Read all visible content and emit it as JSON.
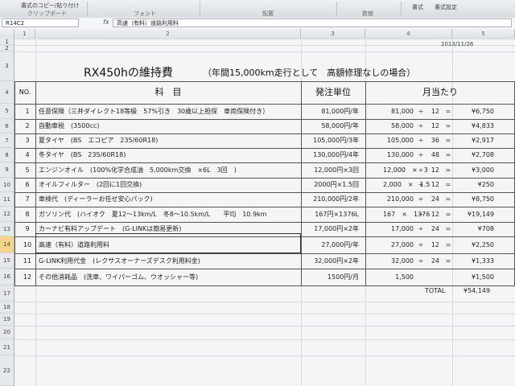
{
  "ribbon": {
    "copy_format": "書式のコピー/貼り付け",
    "group_clipboard": "クリップボード",
    "group_font": "フォント",
    "group_align": "配置",
    "group_number": "数値",
    "format_label": "書式",
    "style_label": "書式設定"
  },
  "formula_bar": {
    "name_box": "R14C2",
    "fx": "fx",
    "content": "高速（有料）道路利用料"
  },
  "columns": [
    "1",
    "2",
    "3",
    "4",
    "5"
  ],
  "rows": [
    "1",
    "2",
    "3",
    "4",
    "5",
    "6",
    "7",
    "8",
    "9",
    "10",
    "11",
    "12",
    "13",
    "14",
    "15",
    "16",
    "17",
    "18",
    "19",
    "20",
    "21",
    "22"
  ],
  "sheet": {
    "date": "2013/11/26",
    "title": "RX450hの維持費",
    "subtitle": "（年間15,000km走行として　高額修理なしの場合）",
    "headers": {
      "no": "NO.",
      "item": "科　目",
      "unit": "発注単位",
      "monthly": "月当たり"
    },
    "items": [
      {
        "no": "1",
        "name": "任意保険（三井ダイレクト18等級　57%引き　30歳以上担保　車両保険付き）",
        "unit": "81,000円/年",
        "a": "81,000",
        "op": "÷",
        "b": "12",
        "eq": "=",
        "result": "¥6,750"
      },
      {
        "no": "2",
        "name": "自動車税　(3500cc)",
        "unit": "58,000円/年",
        "a": "58,000",
        "op": "÷",
        "b": "12",
        "eq": "=",
        "result": "¥4,833"
      },
      {
        "no": "3",
        "name": "夏タイヤ　(BS　エコピア　235/60R18)",
        "unit": "105,000円/3年",
        "a": "105,000",
        "op": "÷",
        "b": "36",
        "eq": "=",
        "result": "¥2,917"
      },
      {
        "no": "4",
        "name": "冬タイヤ　(BS　235/60R18)",
        "unit": "130,000円/4年",
        "a": "130,000",
        "op": "÷",
        "b": "48",
        "eq": "=",
        "result": "¥2,708"
      },
      {
        "no": "5",
        "name": "エンジンオイル　(100%化学合成油　5,000km交換　×6L　3回　)",
        "unit": "12,000円×3回",
        "a": "12,000　×　3",
        "op": "÷",
        "b": "12",
        "eq": "=",
        "result": "¥3,000"
      },
      {
        "no": "6",
        "name": "オイルフィルター　(2回に1回交換)",
        "unit": "2000円×1.5回",
        "a": "2,000　×　1.5",
        "op": "÷",
        "b": "12",
        "eq": "=",
        "result": "¥250"
      },
      {
        "no": "7",
        "name": "車検代　(ディーラーお任せ安心パック)",
        "unit": "210,000円/2年",
        "a": "210,000",
        "op": "÷",
        "b": "24",
        "eq": "=",
        "result": "¥8,750"
      },
      {
        "no": "8",
        "name": "ガソリン代　(ハイオク　夏12～13km/L　冬8～10.5km/L　　平均　10.9km",
        "unit": "167円×1376L",
        "a": "167　×　1376",
        "op": "÷",
        "b": "12",
        "eq": "=",
        "result": "¥19,149"
      },
      {
        "no": "9",
        "name": "カーナビ有料アップデート　(G-LINKは簡易更新)",
        "unit": "17,000円×2年",
        "a": "17,000",
        "op": "÷",
        "b": "24",
        "eq": "=",
        "result": "¥708"
      },
      {
        "no": "10",
        "name": "高速（有料）道路利用料",
        "unit": "27,000円/年",
        "a": "27,000",
        "op": "÷",
        "b": "12",
        "eq": "=",
        "result": "¥2,250"
      },
      {
        "no": "11",
        "name": "G-LINK利用代金　(レクサスオーナーズデスク利用料金)",
        "unit": "32,000円×2年",
        "a": "32,000",
        "op": "÷",
        "b": "24",
        "eq": "=",
        "result": "¥1,333"
      },
      {
        "no": "12",
        "name": "その他消耗品　(洗車、ワイパーゴム、ウオッシャー等)",
        "unit": "1500円/月",
        "a": "1,500",
        "op": "",
        "b": "",
        "eq": "",
        "result": "¥1,500"
      }
    ],
    "total_label": "TOTAL",
    "total_value": "¥54,149"
  }
}
